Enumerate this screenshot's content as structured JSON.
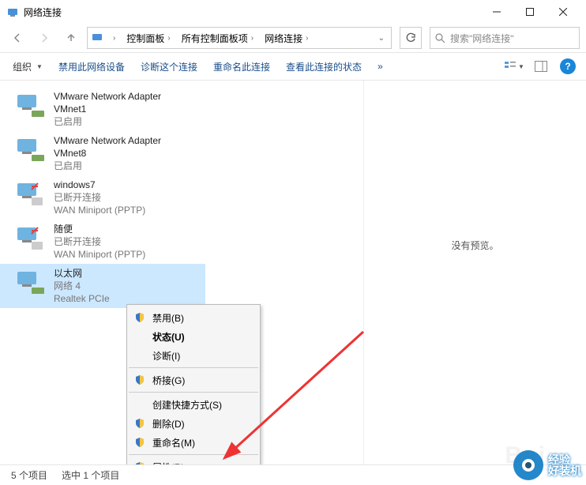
{
  "window": {
    "title": "网络连接"
  },
  "breadcrumbs": {
    "b0": "控制面板",
    "b1": "所有控制面板项",
    "b2": "网络连接"
  },
  "search": {
    "placeholder": "搜索\"网络连接\""
  },
  "commands": {
    "organize": "组织",
    "disable": "禁用此网络设备",
    "diagnose": "诊断这个连接",
    "rename": "重命名此连接",
    "viewstatus": "查看此连接的状态",
    "more": "»"
  },
  "adapters": [
    {
      "name": "VMware Network Adapter VMnet1",
      "status": "已启用",
      "device": ""
    },
    {
      "name": "VMware Network Adapter VMnet8",
      "status": "已启用",
      "device": ""
    },
    {
      "name": "windows7",
      "status": "已断开连接",
      "device": "WAN Miniport (PPTP)"
    },
    {
      "name": "随便",
      "status": "已断开连接",
      "device": "WAN Miniport (PPTP)"
    },
    {
      "name": "以太网",
      "status": "网络 4",
      "device": "Realtek PCIe"
    }
  ],
  "preview": {
    "text": "没有预览。"
  },
  "context_menu": {
    "disable": "禁用(B)",
    "status": "状态(U)",
    "diagnose": "诊断(I)",
    "bridge": "桥接(G)",
    "shortcut": "创建快捷方式(S)",
    "delete": "删除(D)",
    "rename": "重命名(M)",
    "properties": "属性(R)"
  },
  "statusbar": {
    "count": "5 个项目",
    "selected": "选中 1 个项目"
  },
  "watermark": {
    "line1": "经验",
    "line2": "好装机",
    "baidu": "Bai"
  }
}
